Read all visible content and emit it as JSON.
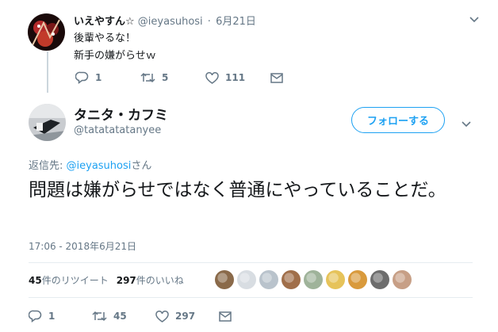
{
  "reply_tweet": {
    "name": "いえやすん☆",
    "handle": "@ieyasuhosi",
    "separator": "·",
    "date": "6月21日",
    "lines": [
      "後輩やるな！",
      "新手の嫌がらせｗ"
    ],
    "reply_count": "1",
    "retweet_count": "5",
    "like_count": "111"
  },
  "main_tweet": {
    "name": "タニタ・カフミ",
    "handle": "@tatatatatanyee",
    "follow_label": "フォローする",
    "reply_to_prefix": "返信先: ",
    "reply_to_mention": "@ieyasuhosi",
    "reply_to_suffix": "さん",
    "text": "問題は嫌がらせではなく普通にやっていることだ。",
    "timestamp": "17:06 - 2018年6月21日",
    "retweets_num": "45",
    "retweets_label": "件のリツイート",
    "likes_num": "297",
    "likes_label": "件のいいね",
    "reply_count": "1",
    "retweet_count": "45",
    "like_count": "297"
  },
  "colors": {
    "accent": "#1da1f2",
    "muted": "#657786",
    "text": "#14171a",
    "thread_line": "#ccd6dd"
  },
  "likers": [
    {
      "color": "#8a6a4a"
    },
    {
      "color": "#d8dde2"
    },
    {
      "color": "#b9c3cc"
    },
    {
      "color": "#a06f4a"
    },
    {
      "color": "#9fb39a"
    },
    {
      "color": "#e6c35a"
    },
    {
      "color": "#d99a3c"
    },
    {
      "color": "#6d6d6d"
    },
    {
      "color": "#c79f86"
    }
  ]
}
